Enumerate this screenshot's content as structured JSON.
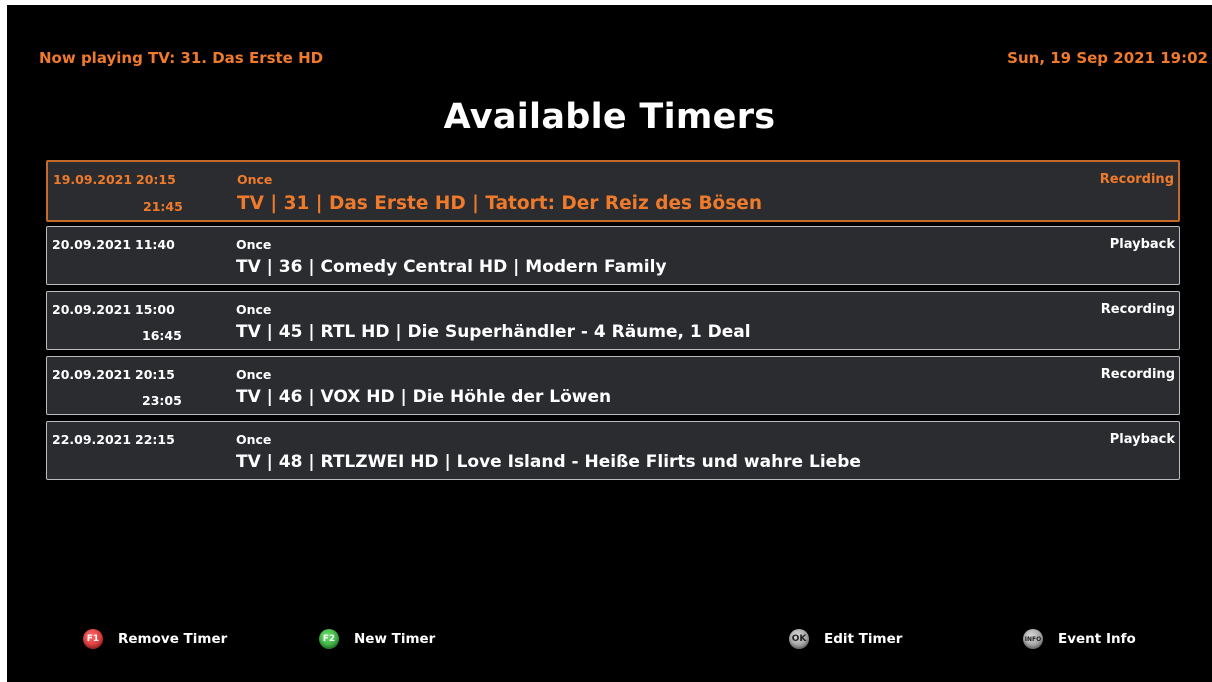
{
  "header": {
    "now_playing": "Now playing TV: 31. Das Erste HD",
    "datetime": "Sun, 19 Sep 2021 19:02"
  },
  "title": "Available Timers",
  "timers": [
    {
      "date": "19.09.2021",
      "start": "20:15",
      "end": "21:45",
      "repeat": "Once",
      "event": "TV | 31 | Das Erste HD | Tatort: Der Reiz des Bösen",
      "type": "Recording",
      "selected": true
    },
    {
      "date": "20.09.2021",
      "start": "11:40",
      "end": "",
      "repeat": "Once",
      "event": "TV | 36 | Comedy Central HD | Modern Family",
      "type": "Playback",
      "selected": false
    },
    {
      "date": "20.09.2021",
      "start": "15:00",
      "end": "16:45",
      "repeat": "Once",
      "event": "TV | 45 | RTL HD | Die Superhändler - 4 Räume, 1 Deal",
      "type": "Recording",
      "selected": false
    },
    {
      "date": "20.09.2021",
      "start": "20:15",
      "end": "23:05",
      "repeat": "Once",
      "event": "TV | 46 | VOX HD | Die Höhle der Löwen",
      "type": "Recording",
      "selected": false
    },
    {
      "date": "22.09.2021",
      "start": "22:15",
      "end": "",
      "repeat": "Once",
      "event": "TV | 48 | RTLZWEI HD | Love Island - Heiße Flirts und wahre Liebe",
      "type": "Playback",
      "selected": false
    }
  ],
  "footer": {
    "keys": [
      {
        "icon_text": "F1",
        "icon": "red-f1-key-icon",
        "color": "#d32a2a",
        "label": "Remove Timer"
      },
      {
        "icon_text": "F2",
        "icon": "green-f2-key-icon",
        "color": "#2ea23a",
        "label": "New Timer"
      },
      {
        "icon_text": "OK",
        "icon": "ok-key-icon",
        "color": "#9a9a9a",
        "label": "Edit Timer"
      },
      {
        "icon_text": "INFO",
        "icon": "info-key-icon",
        "color": "#9a9a9a",
        "label": "Event Info"
      }
    ]
  },
  "colors": {
    "accent": "#ef7a2c",
    "row_bg": "#2a2c30",
    "row_border": "#b9bcc1",
    "background": "#000000"
  }
}
